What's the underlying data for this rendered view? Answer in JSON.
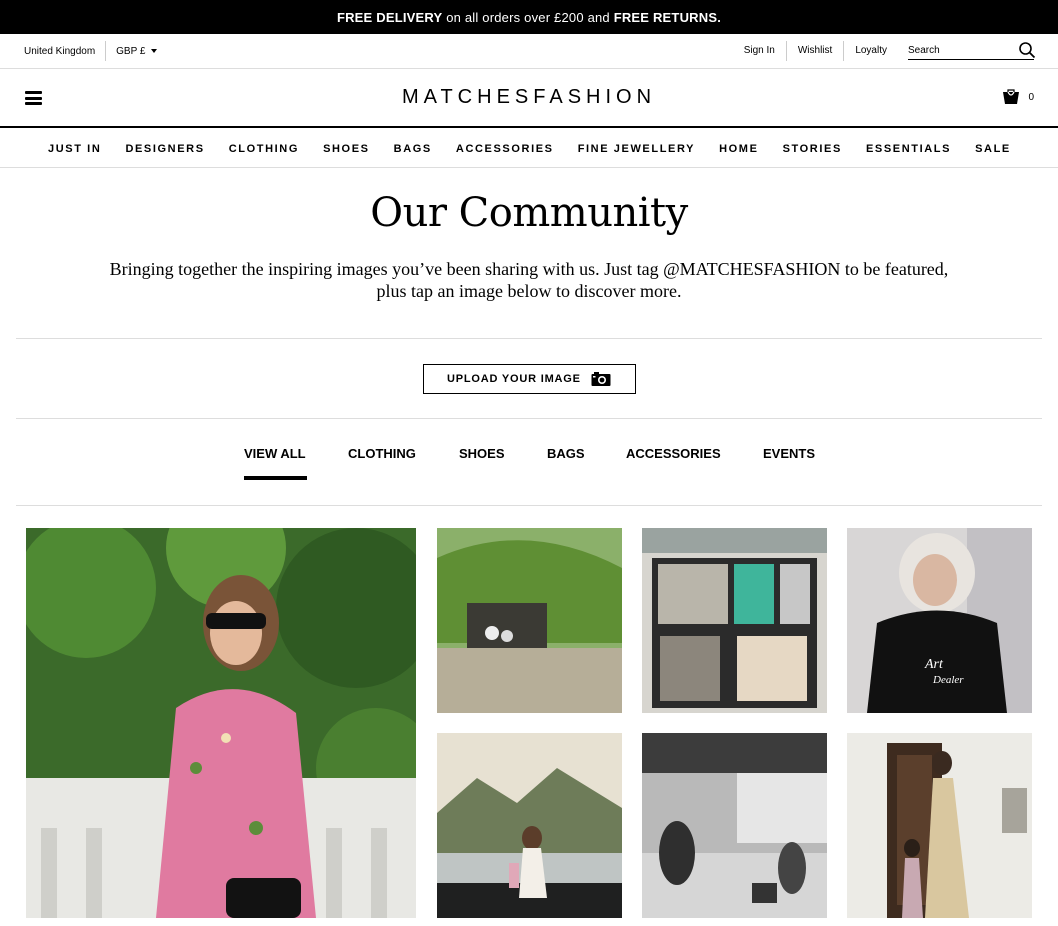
{
  "promo": {
    "free_delivery": "FREE DELIVERY",
    "on_orders": "on all orders over £200 and",
    "free_returns": "FREE RETURNS."
  },
  "utility": {
    "region": "United Kingdom",
    "currency": "GBP £",
    "sign_in": "Sign In",
    "wishlist": "Wishlist",
    "loyalty": "Loyalty",
    "search_placeholder": "Search"
  },
  "header": {
    "logo": "MATCHESFASHION",
    "bag_count": "0"
  },
  "nav": [
    "JUST IN",
    "DESIGNERS",
    "CLOTHING",
    "SHOES",
    "BAGS",
    "ACCESSORIES",
    "FINE JEWELLERY",
    "HOME",
    "STORIES",
    "ESSENTIALS",
    "SALE"
  ],
  "community": {
    "title": "Our Community",
    "intro_line1": "Bringing together the inspiring images you’ve been sharing with us. Just tag @MATCHESFASHION to be featured,",
    "intro_line2": "plus tap an image below to discover more.",
    "upload_label": "UPLOAD YOUR IMAGE"
  },
  "filters": {
    "tabs": [
      "VIEW ALL",
      "CLOTHING",
      "SHOES",
      "BAGS",
      "ACCESSORIES",
      "EVENTS"
    ],
    "active": "VIEW ALL"
  },
  "colors": {
    "promo_bg": "#000000",
    "text": "#000000",
    "divider": "#dddddd"
  },
  "icons": [
    "hamburger-menu-icon",
    "shopping-bag-icon",
    "search-icon",
    "camera-icon"
  ]
}
